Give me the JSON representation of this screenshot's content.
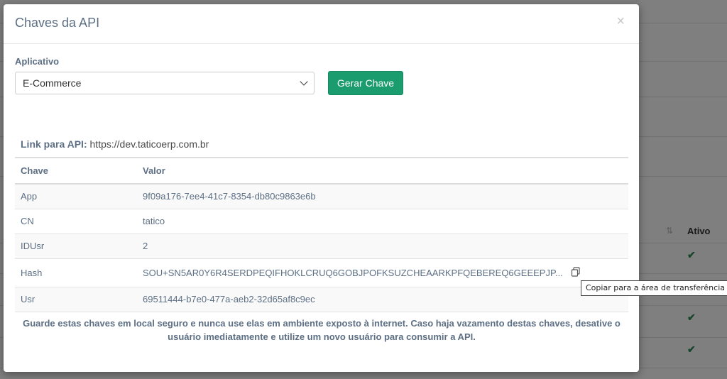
{
  "background": {
    "ativo_header": "Ativo",
    "check_symbol": "✔"
  },
  "modal": {
    "title": "Chaves da API",
    "close_symbol": "×",
    "application_label": "Aplicativo",
    "application_selected": "E-Commerce",
    "generate_button": "Gerar Chave",
    "api_link_label": "Link para API:",
    "api_link_url": "https://dev.taticoerp.com.br",
    "table": {
      "headers": [
        "Chave",
        "Valor"
      ],
      "rows": [
        {
          "key": "App",
          "value": "9f09a176-7ee4-41c7-8354-db80c9863e6b"
        },
        {
          "key": "CN",
          "value": "tatico"
        },
        {
          "key": "IDUsr",
          "value": "2"
        },
        {
          "key": "Hash",
          "value": "SOU+SN5AR0Y6R4SERDPEQIFHOKLCRUQ6GOBJPOFKSUZCHEAARKPFQEBEREQ6GEEEPJP..."
        },
        {
          "key": "Usr",
          "value": "69511444-b7e0-477a-aeb2-32d65af8c9ec"
        }
      ]
    },
    "copy_tooltip": "Copiar para a área de transferência",
    "warning": "Guarde estas chaves em local seguro e nunca use elas em ambiente exposto à internet. Caso haja vazamento destas chaves, desative o usuário imediatamente e utilize um novo usuário para consumir a API."
  },
  "colors": {
    "accent_green": "#1a9c6e",
    "title_color": "#5d6f84"
  }
}
